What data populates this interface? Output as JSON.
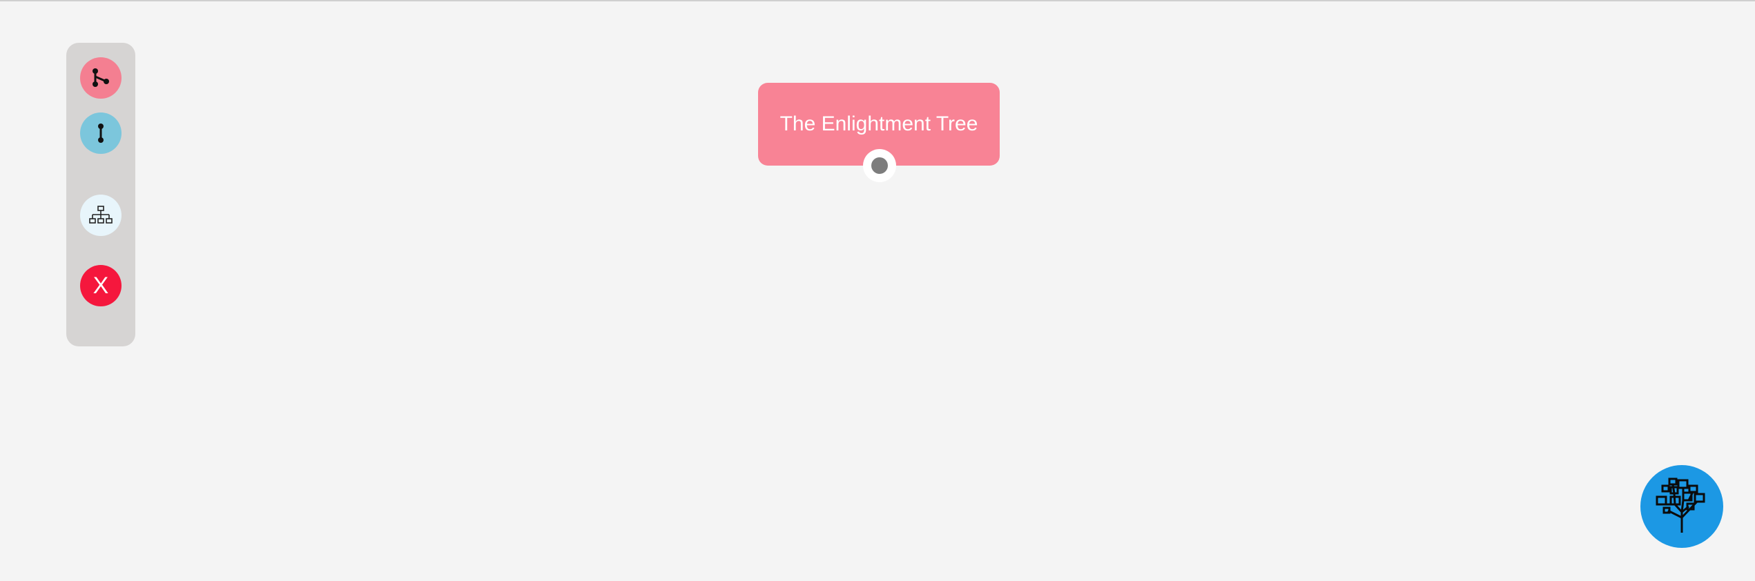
{
  "toolbar": {
    "buttons": [
      {
        "name": "add-branch",
        "icon": "branch-icon",
        "color": "#f47f91"
      },
      {
        "name": "add-link",
        "icon": "link-node-icon",
        "color": "#7cc6dc"
      },
      {
        "name": "tree-layout",
        "icon": "hierarchy-icon",
        "color": "#e8f5fb"
      },
      {
        "name": "delete",
        "icon": "close-icon",
        "label": "X",
        "color": "#f5173d"
      }
    ]
  },
  "canvas": {
    "root_node": {
      "label": "The Enlightment Tree",
      "color": "#f88395"
    }
  },
  "fab": {
    "icon": "tree-logo-icon",
    "color": "#1c98e4"
  }
}
